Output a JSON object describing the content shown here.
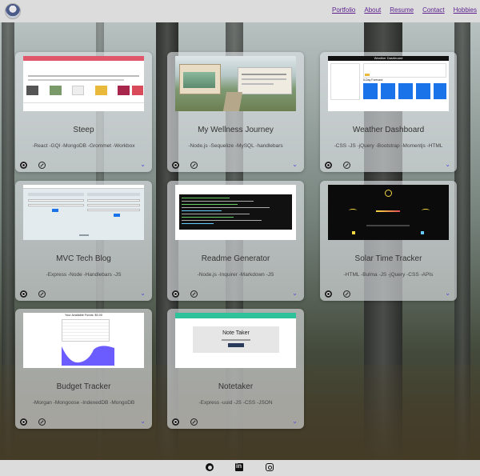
{
  "navbar": {
    "links": [
      "Portfolio",
      "About",
      "Resume",
      "Contact",
      "Hobbies"
    ]
  },
  "projects": [
    {
      "title": "Steep",
      "tech": "-React -GQl -MongoDB -Grommet -Workbox",
      "thumb": "steep"
    },
    {
      "title": "My Wellness Journey",
      "tech": "-Node.js -Sequelize -MySQL -handlebars",
      "thumb": "wellness"
    },
    {
      "title": "Weather Dashboard",
      "tech": "-CSS -JS -jQuery -Bootstrap -Momentjs -HTML",
      "thumb": "weather"
    },
    {
      "title": "MVC Tech Blog",
      "tech": "-Express -Node -Handlebars -JS",
      "thumb": "blog"
    },
    {
      "title": "Readme Generator",
      "tech": "-Node.js -Inquirer -Markdown -JS",
      "thumb": "readme"
    },
    {
      "title": "Solar Time Tracker",
      "tech": "-HTML -Bulma -JS -jQuery -CSS -APIs",
      "thumb": "solar"
    },
    {
      "title": "Budget Tracker",
      "tech": "-Morgan -Mongoose -IndexedDB -MongoDB",
      "thumb": "budget"
    },
    {
      "title": "Notetaker",
      "tech": "-Express -uuid -JS -CSS -JSON",
      "thumb": "note"
    }
  ],
  "thumb_text": {
    "weather_title": "Weather Dashboard",
    "weather_forecast": "5-Day Forecast:",
    "note_title": "Note Taker",
    "budget_title": "Your Available Funds: $0.00"
  },
  "footer": {
    "icons": [
      "github-icon",
      "linkedin-icon",
      "instagram-icon"
    ]
  },
  "colors": {
    "nav_link": "#5a1f8c",
    "chevron": "#4a4adc",
    "card_bg": "rgba(225,228,230,0.62)",
    "steep_accent": "#e0566a",
    "weather_accent": "#1a73e8",
    "note_accent": "#2ec29a",
    "budget_chart": "#6a5cff"
  }
}
